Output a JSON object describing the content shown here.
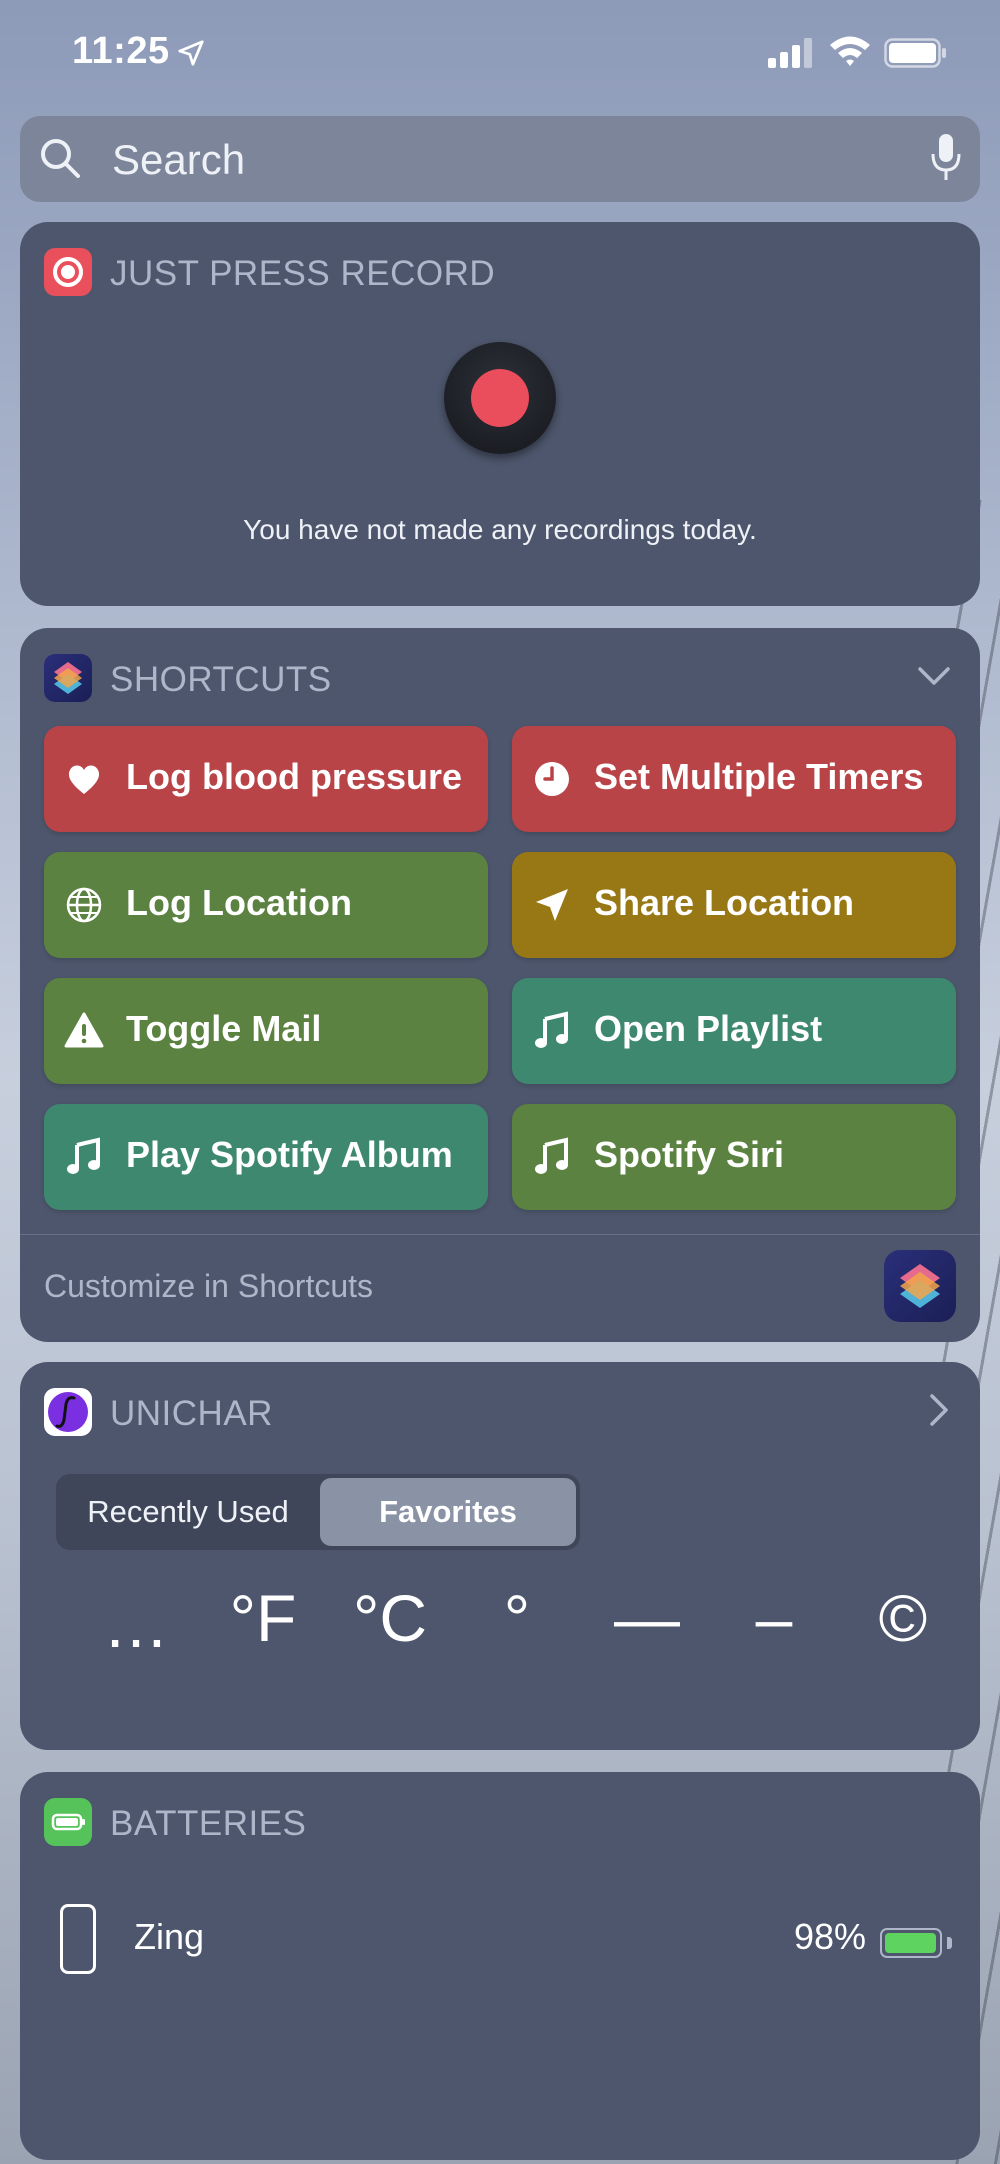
{
  "status_bar": {
    "time": "11:25",
    "icons": [
      "location-arrow-icon",
      "signal-icon",
      "wifi-icon",
      "battery-icon"
    ]
  },
  "search": {
    "placeholder": "Search",
    "icons": [
      "search-icon",
      "mic-icon"
    ]
  },
  "just_press_record": {
    "title": "JUST PRESS RECORD",
    "message": "You have not made any recordings today.",
    "colors": {
      "accent": "#ea4d5b"
    }
  },
  "shortcuts": {
    "title": "SHORTCUTS",
    "buttons": [
      {
        "label": "Log blood pressure",
        "icon": "heart-icon",
        "color": "#b94448"
      },
      {
        "label": "Set Multiple Timers",
        "icon": "clock-icon",
        "color": "#b94448"
      },
      {
        "label": "Log Location",
        "icon": "globe-icon",
        "color": "#5b8240"
      },
      {
        "label": "Share Location",
        "icon": "location-arrow-icon",
        "color": "#987715"
      },
      {
        "label": "Toggle Mail",
        "icon": "warning-icon",
        "color": "#5b8240"
      },
      {
        "label": "Open Playlist",
        "icon": "music-note-icon",
        "color": "#3f8870"
      },
      {
        "label": "Play Spotify Album",
        "icon": "music-note-icon",
        "color": "#3f8870"
      },
      {
        "label": "Spotify Siri",
        "icon": "music-note-icon",
        "color": "#5b8240"
      }
    ],
    "footer": "Customize in Shortcuts"
  },
  "unichar": {
    "title": "UNICHAR",
    "segments": [
      "Recently Used",
      "Favorites"
    ],
    "selected_segment": "Favorites",
    "chars": [
      "…",
      "°F",
      "°C",
      "°",
      "—",
      "–",
      "©"
    ]
  },
  "batteries": {
    "title": "BATTERIES",
    "device": {
      "name": "Zing",
      "percent": "98%",
      "level": 0.98
    },
    "colors": {
      "fill": "#5fd35f"
    }
  }
}
